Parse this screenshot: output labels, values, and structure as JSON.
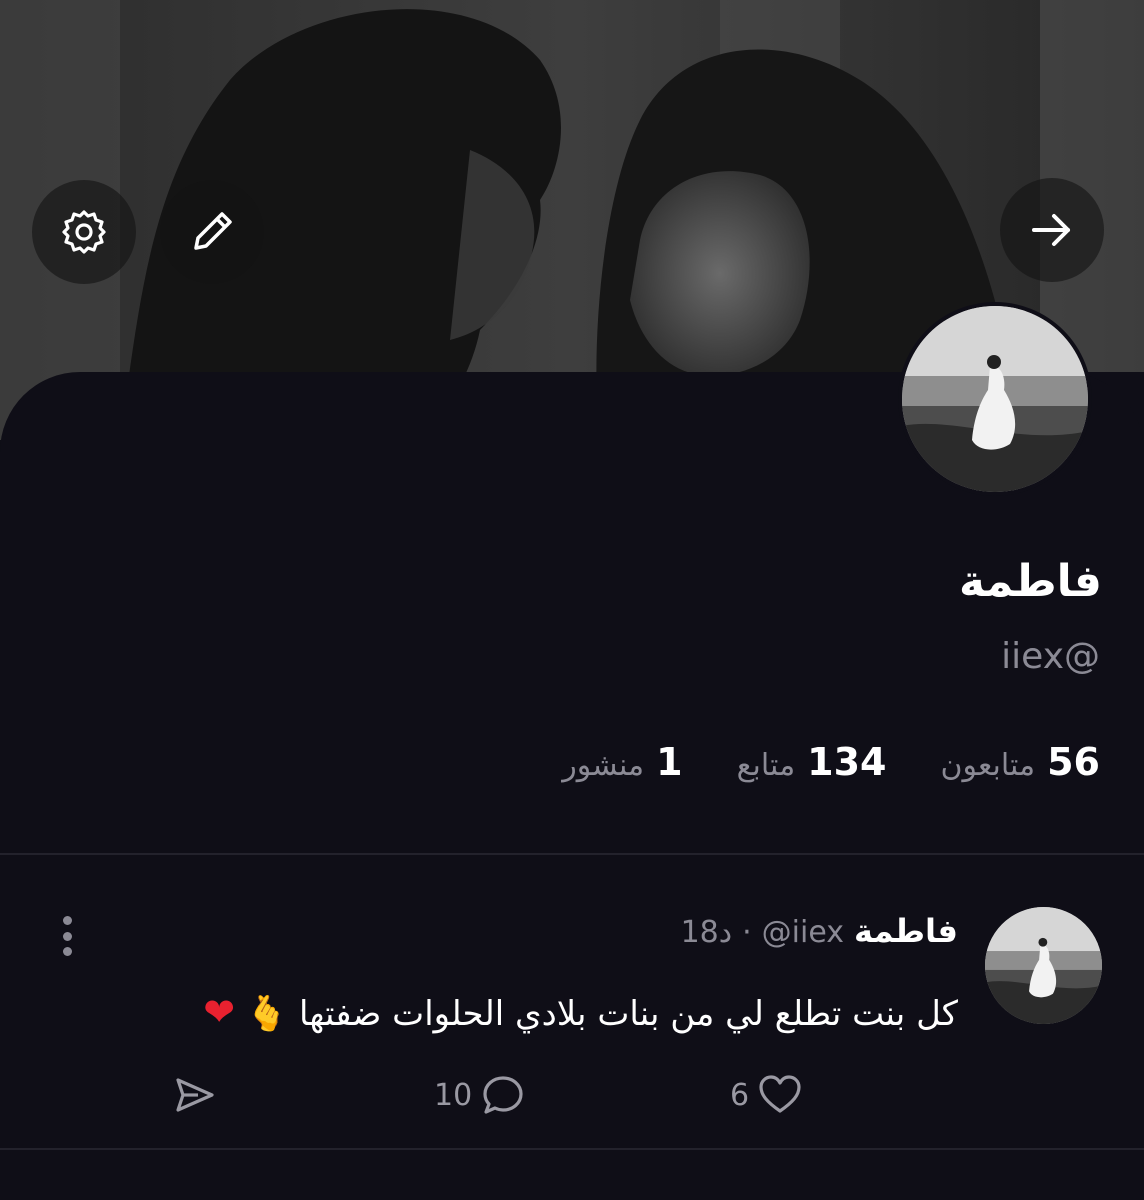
{
  "header": {
    "cover_description_icon": "couple-photo",
    "buttons": {
      "back_icon": "arrow-right-icon",
      "edit_icon": "pencil-icon",
      "settings_icon": "gear-icon"
    }
  },
  "profile": {
    "display_name": "فاطمة",
    "handle": "iiex@",
    "stats": [
      {
        "value": "56",
        "label": "متابعون"
      },
      {
        "value": "134",
        "label": "متابع"
      },
      {
        "value": "1",
        "label": "منشور"
      }
    ]
  },
  "post": {
    "author_name": "فاطمة",
    "author_handle": "@iiex",
    "time": "18د",
    "text": "كل بنت تطلع لي من بنات بلادي الحلوات ضفتها",
    "likes": "6",
    "comments": "10"
  },
  "colors": {
    "background": "#0f0e17",
    "muted_text": "#8b8a95",
    "heart": "#e8212f"
  }
}
